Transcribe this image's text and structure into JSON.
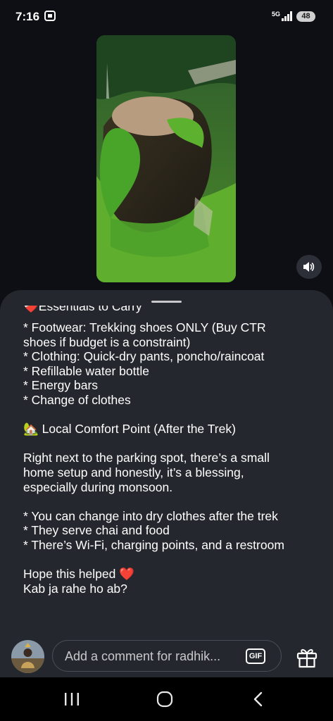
{
  "status_bar": {
    "time": "7:16",
    "network": "5G",
    "battery": "48"
  },
  "post": {
    "caption_lines": [
      "❤️‍🩹Essentials to Carry",
      "",
      "* Footwear: Trekking shoes ONLY (Buy CTR",
      "shoes if budget is a constraint)",
      "* Clothing: Quick-dry pants, poncho/raincoat",
      "* Refillable water bottle",
      "* Energy bars",
      "* Change of clothes",
      "",
      "🏡 Local Comfort Point (After the Trek)",
      "",
      "Right next to the parking spot, there’s a small",
      "home setup and honestly, it’s a blessing,",
      "especially during monsoon.",
      "",
      "* You can change into dry clothes after the trek",
      "* They serve chai and food",
      "* There’s Wi-Fi, charging points, and a restroom",
      "",
      "Hope this helped ❤️",
      "Kab ja rahe ho ab?"
    ]
  },
  "comment_bar": {
    "placeholder": "Add a comment for radhik...",
    "gif_label": "GIF"
  },
  "icons": {
    "sound": "speaker-icon",
    "gift": "gift-icon",
    "nav_recents": "recents-icon",
    "nav_home": "home-icon",
    "nav_back": "back-icon"
  },
  "colors": {
    "background": "#0e0f14",
    "sheet": "#25272e",
    "heart": "#ff3b5c"
  }
}
